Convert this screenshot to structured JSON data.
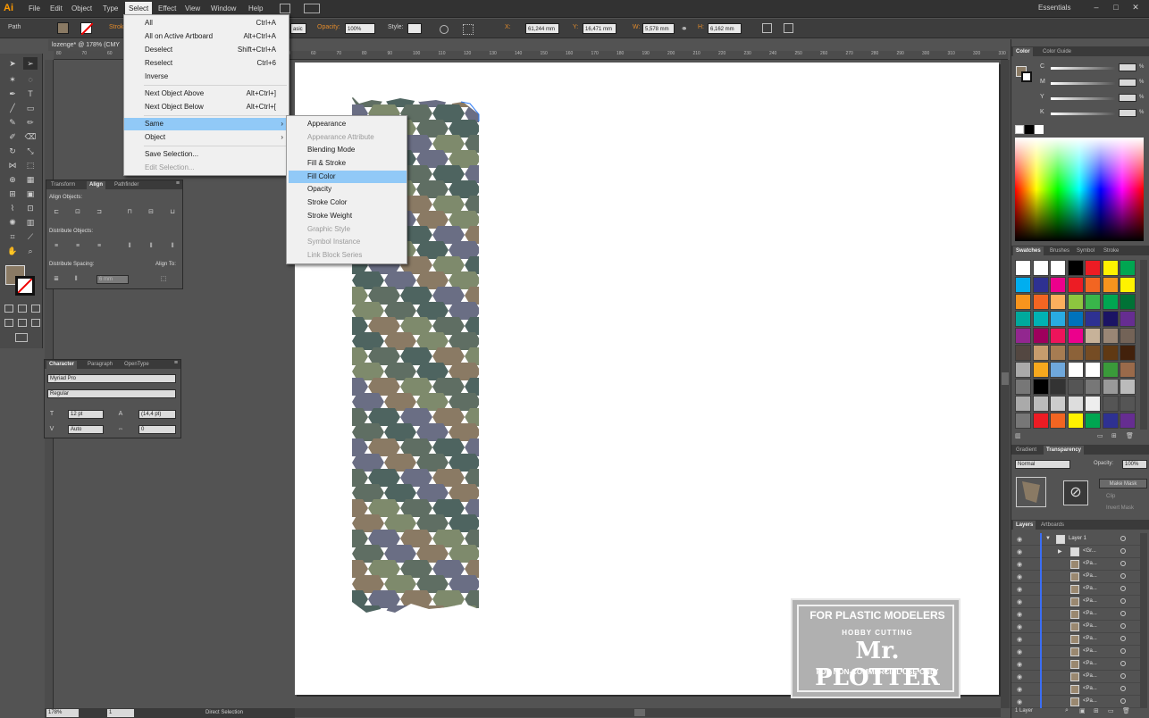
{
  "app": {
    "logo": "Ai",
    "workspace": "Essentials"
  },
  "menubar": [
    "File",
    "Edit",
    "Object",
    "Type",
    "Select",
    "Effect",
    "View",
    "Window",
    "Help"
  ],
  "control_bar": {
    "object_type": "Path",
    "stroke_label": "Stroke:",
    "style_value": "asic",
    "opacity_label": "Opacity:",
    "opacity_value": "100%",
    "style_label": "Style:",
    "x_label": "X:",
    "x_value": "61,244 mm",
    "y_label": "Y:",
    "y_value": "16,471 mm",
    "w_label": "W:",
    "w_value": "5,578 mm",
    "h_label": "H:",
    "h_value": "6,162 mm"
  },
  "document": {
    "tab_title": "lozenge* @ 178% (CMY"
  },
  "ruler_top": [
    "80",
    "70",
    "60",
    "10",
    "0",
    "10",
    "20",
    "30",
    "40",
    "50",
    "60",
    "70",
    "80",
    "90",
    "100",
    "110",
    "120",
    "130",
    "140",
    "150",
    "160",
    "170",
    "180",
    "190",
    "200",
    "210",
    "220",
    "230",
    "240",
    "250",
    "260",
    "270",
    "280",
    "290",
    "300",
    "310",
    "320",
    "330"
  ],
  "select_menu": {
    "items": [
      {
        "label": "All",
        "shortcut": "Ctrl+A"
      },
      {
        "label": "All on Active Artboard",
        "shortcut": "Alt+Ctrl+A"
      },
      {
        "label": "Deselect",
        "shortcut": "Shift+Ctrl+A"
      },
      {
        "label": "Reselect",
        "shortcut": "Ctrl+6"
      },
      {
        "label": "Inverse",
        "shortcut": ""
      },
      {
        "label": "Next Object Above",
        "shortcut": "Alt+Ctrl+]"
      },
      {
        "label": "Next Object Below",
        "shortcut": "Alt+Ctrl+["
      },
      {
        "label": "Same",
        "shortcut": ""
      },
      {
        "label": "Object",
        "shortcut": ""
      },
      {
        "label": "Save Selection...",
        "shortcut": ""
      },
      {
        "label": "Edit Selection...",
        "shortcut": ""
      }
    ],
    "submenu_arrow": "›"
  },
  "same_submenu": {
    "items": [
      "Appearance",
      "Appearance Attribute",
      "Blending Mode",
      "Fill & Stroke",
      "Fill Color",
      "Opacity",
      "Stroke Color",
      "Stroke Weight",
      "Graphic Style",
      "Symbol Instance",
      "Link Block Series"
    ]
  },
  "align_panel": {
    "tabs": [
      "Transform",
      "Align",
      "Pathfinder"
    ],
    "align_objects": "Align Objects:",
    "distribute_objects": "Distribute Objects:",
    "distribute_spacing": "Distribute Spacing:",
    "align_to": "Align To:",
    "spacing_value": "6 mm"
  },
  "character_panel": {
    "tabs": [
      "Character",
      "Paragraph",
      "OpenType"
    ],
    "font_family": "Myriad Pro",
    "font_style": "Regular",
    "font_size": "12 pt",
    "leading": "(14,4 pt)",
    "kerning": "Auto",
    "tracking": "0"
  },
  "color_panel": {
    "tabs": [
      "Color",
      "Color Guide"
    ],
    "channels": [
      "C",
      "M",
      "Y",
      "K"
    ],
    "unit": "%"
  },
  "swatches_panel": {
    "tabs": [
      "Swatches",
      "Brushes",
      "Symbol",
      "Stroke"
    ],
    "colors": [
      [
        "#ffffff",
        "#ffffff",
        "#ffffff",
        "#000000",
        "#ed1c24",
        "#fff200",
        "#00a651"
      ],
      [
        "#00aeef",
        "#2e3192",
        "#ec008c",
        "#ed1c24",
        "#f26522",
        "#f7941d",
        "#fff200"
      ],
      [
        "#f7941d",
        "#f26522",
        "#fbaf5d",
        "#8dc63f",
        "#39b54a",
        "#00a651",
        "#007236"
      ],
      [
        "#00a99d",
        "#00b2b3",
        "#29abe2",
        "#0072bc",
        "#2e3192",
        "#1b1464",
        "#662d91"
      ],
      [
        "#92278f",
        "#9e005d",
        "#ed145b",
        "#ec008c",
        "#c7b299",
        "#998675",
        "#736357"
      ],
      [
        "#534741",
        "#c69c6d",
        "#a67c52",
        "#8c6239",
        "#754c24",
        "#603913",
        "#42210b"
      ],
      [
        "#aaaaaa",
        "#f7a81d",
        "#6fa8dc",
        "#ffffff",
        "#ffffff",
        "#3a9a3a",
        "#9a6a4a"
      ],
      [
        "#777777",
        "#000000",
        "#333333",
        "#555555",
        "#777777",
        "#999999",
        "#bbbbbb"
      ],
      [
        "#aaaaaa",
        "#bbbbbb",
        "#cccccc",
        "#dddddd",
        "#eeeeee",
        "#555555",
        "#555555"
      ],
      [
        "#777777",
        "#ed1c24",
        "#f26522",
        "#fff200",
        "#00a651",
        "#2e3192",
        "#662d91"
      ]
    ]
  },
  "transparency_panel": {
    "tabs": [
      "Gradient",
      "Transparency"
    ],
    "blend_mode": "Normal",
    "opacity_label": "Opacity:",
    "opacity_value": "100%",
    "make_mask": "Make Mask",
    "clip": "Clip",
    "invert_mask": "Invert Mask"
  },
  "layers_panel": {
    "tabs": [
      "Layers",
      "Artboards"
    ],
    "layer_name": "Layer 1",
    "group_name": "<Gr...",
    "path_name": "<Pa...",
    "rows": 12,
    "count": "1 Layer"
  },
  "status_bar": {
    "zoom": "178%",
    "artboard": "1",
    "tool": "Direct Selection"
  },
  "watermark": {
    "line1": "FOR PLASTIC MODELERS",
    "line2": "HOBBY CUTTING",
    "line3": "Mr. PLOTTER",
    "line4": "FOR NON-COMMERCIAL USE ONLY"
  },
  "colors": {
    "camo": [
      "#8a7a64",
      "#5f6e63",
      "#6a6e84",
      "#7e8a6c",
      "#4e6460"
    ]
  }
}
